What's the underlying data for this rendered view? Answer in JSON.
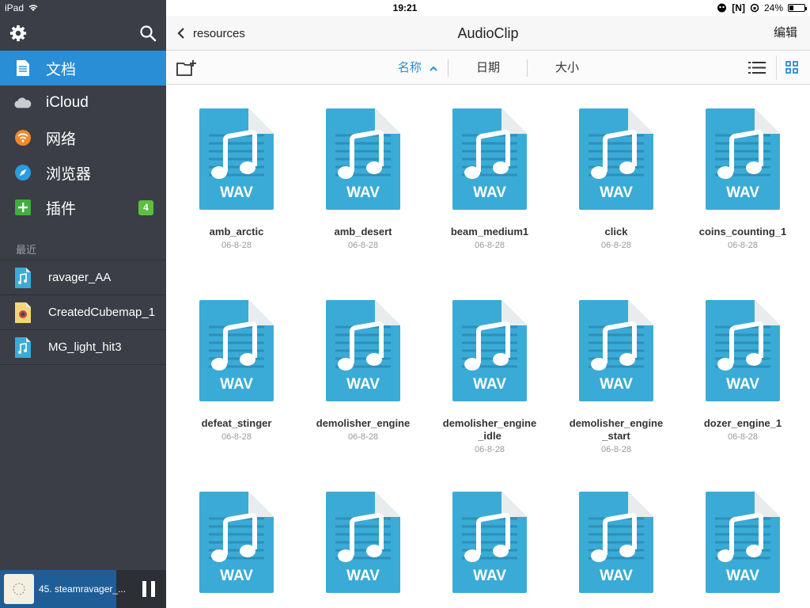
{
  "status": {
    "device": "iPad",
    "time": "19:21",
    "battery": "24%",
    "battery_level": 0.24,
    "n_indicator": "[N]"
  },
  "sidebar": {
    "items": [
      {
        "label": "文档",
        "icon": "document-icon"
      },
      {
        "label": "iCloud",
        "icon": "cloud-icon"
      },
      {
        "label": "网络",
        "icon": "wifi-icon"
      },
      {
        "label": "浏览器",
        "icon": "compass-icon"
      },
      {
        "label": "插件",
        "icon": "plus-icon",
        "badge": "4"
      }
    ],
    "recent_label": "最近",
    "recent": [
      {
        "label": "ravager_AA",
        "icon": "audio-file-icon"
      },
      {
        "label": "CreatedCubemap_1",
        "icon": "image-file-icon"
      },
      {
        "label": "MG_light_hit3",
        "icon": "audio-file-icon"
      }
    ]
  },
  "player": {
    "title": "45. steamravager_...",
    "progress": 0.7
  },
  "header": {
    "back_label": "resources",
    "title": "AudioClip",
    "edit_label": "编辑"
  },
  "toolbar": {
    "sort_name": "名称",
    "sort_date": "日期",
    "sort_size": "大小"
  },
  "file_type_label": "WAV",
  "files": [
    {
      "name": "amb_arctic",
      "date": "06-8-28"
    },
    {
      "name": "amb_desert",
      "date": "06-8-28"
    },
    {
      "name": "beam_medium1",
      "date": "06-8-28"
    },
    {
      "name": "click",
      "date": "06-8-28"
    },
    {
      "name": "coins_counting_1",
      "date": "06-8-28"
    },
    {
      "name": "defeat_stinger",
      "date": "06-8-28"
    },
    {
      "name": "demolisher_engine",
      "date": "06-8-28"
    },
    {
      "name": "demolisher_engine\n_idle",
      "date": "06-8-28"
    },
    {
      "name": "demolisher_engine\n_start",
      "date": "06-8-28"
    },
    {
      "name": "dozer_engine_1",
      "date": "06-8-28"
    },
    {
      "name": "",
      "date": ""
    },
    {
      "name": "",
      "date": ""
    },
    {
      "name": "",
      "date": ""
    },
    {
      "name": "",
      "date": ""
    },
    {
      "name": "",
      "date": ""
    }
  ],
  "colors": {
    "accent": "#2a8ed6",
    "sidebar": "#3b3e46",
    "wav": "#3aabd6",
    "badge": "#5dbf3f"
  }
}
